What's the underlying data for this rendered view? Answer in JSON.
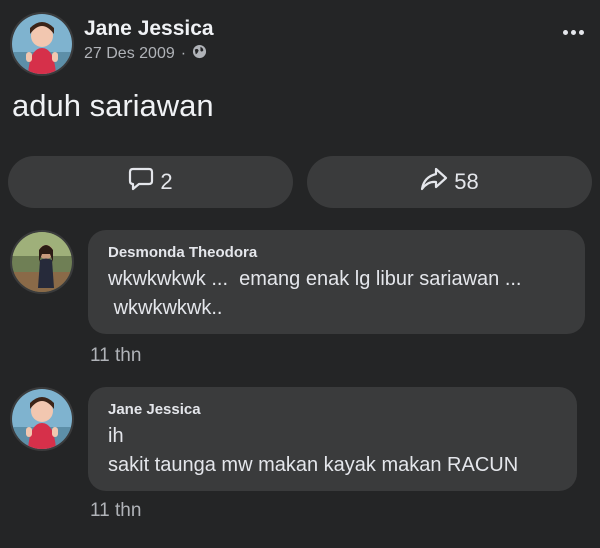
{
  "post": {
    "author": "Jane Jessica",
    "date": "27 Des 2009",
    "separator": "·",
    "privacy_icon": "globe-icon",
    "text": "aduh sariawan",
    "more_icon": "more-horizontal-icon"
  },
  "actions": {
    "comment_count": "2",
    "comment_icon": "speech-bubble-icon",
    "share_count": "58",
    "share_icon": "share-arrow-icon"
  },
  "comments": [
    {
      "name": "Desmonda Theodora",
      "text": "wkwkwkwk ...  emang enak lg libur sariawan ...\n wkwkwkwk..",
      "time": "11 thn"
    },
    {
      "name": "Jane Jessica",
      "text": "ih\nsakit taunga mw makan kayak makan RACUN",
      "time": "11 thn"
    }
  ],
  "colors": {
    "background": "#242526",
    "surface": "#3a3b3c",
    "text_primary": "#e4e6eb",
    "text_secondary": "#b0b3b8"
  }
}
